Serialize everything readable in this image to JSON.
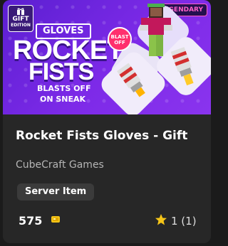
{
  "hero": {
    "gift_badge": {
      "line1": "GIFT",
      "line2": "EDITION"
    },
    "rarity": "LEGENDARY",
    "category_tag": "GLOVES",
    "title_line1": "ROCKET",
    "title_line2": "FISTS",
    "subtitle_line1": "BLASTS OFF",
    "subtitle_line2": "ON SNEAK",
    "sticker": {
      "line1": "BLAST",
      "line2": "OFF"
    }
  },
  "item": {
    "name": "Rocket Fists Gloves - Gift",
    "publisher": "CubeCraft Games",
    "type_chip": "Server Item",
    "price": "575",
    "currency_icon": "minecoin-icon",
    "rating_icon": "star-icon",
    "rating": "1 (1)"
  },
  "colors": {
    "hero_bg": "#7d2ae8",
    "rarity_text": "#ff5fc8",
    "card_bg": "#272727",
    "coin": "#f5c518",
    "star": "#f5c518"
  }
}
